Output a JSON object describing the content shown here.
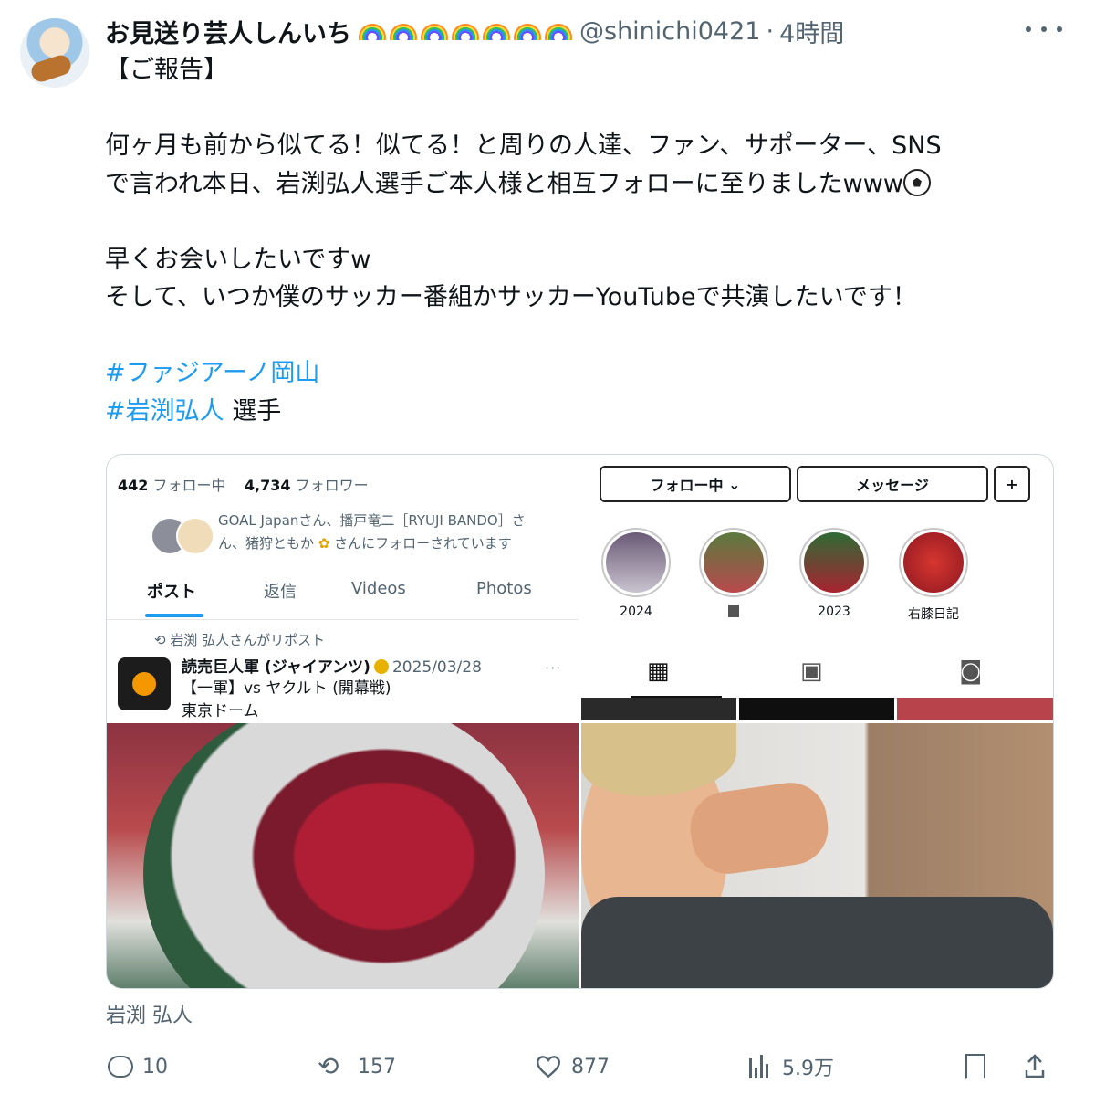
{
  "header": {
    "display_name": "お見送り芸人しんいち",
    "rainbow_count": 7,
    "handle": "@shinichi0421",
    "separator": "·",
    "time": "4時間"
  },
  "tweet": {
    "lines": [
      "【ご報告】",
      "",
      "何ヶ月も前から似てる！似てる！と周りの人達、ファン、サポーター、SNS",
      "で言われ本日、岩渕弘人選手ご本人様と相互フォローに至りましたwww",
      "",
      "早くお会いしたいですw",
      "そして、いつか僕のサッカー番組かサッカーYouTubeで共演したいです！",
      ""
    ],
    "hashtag1": "#ファジアーノ岡山",
    "hashtag2": "#岩渕弘人",
    "hashtag2_suffix": " 選手"
  },
  "media": {
    "x_profile": {
      "following_count": "442",
      "following_label": "フォロー中",
      "followers_count": "4,734",
      "followers_label": "フォロワー",
      "followed_by_part1": "GOAL Japanさん、播戸竜二［RYUJI BANDO］さ",
      "followed_by_part2": "ん、猪狩ともか",
      "followed_by_part3": "さんにフォローされています",
      "tabs": [
        "ポスト",
        "返信",
        "Videos",
        "Photos"
      ],
      "repost_label": "岩渕 弘人さんがリポスト",
      "rt_author": "読売巨人軍 (ジャイアンツ)",
      "rt_date": "2025/03/28",
      "rt_more": "···",
      "rt_line1": "【一軍】vs ヤクルト (開幕戦)",
      "rt_line2": "東京ドーム"
    },
    "instagram": {
      "following_button": "フォロー中",
      "message_button": "メッセージ",
      "stories": [
        "2024",
        "",
        "2023",
        "右膝日記"
      ]
    }
  },
  "caption": "岩渕 弘人",
  "actions": {
    "replies": "10",
    "reposts": "157",
    "likes": "877",
    "views": "5.9万"
  }
}
